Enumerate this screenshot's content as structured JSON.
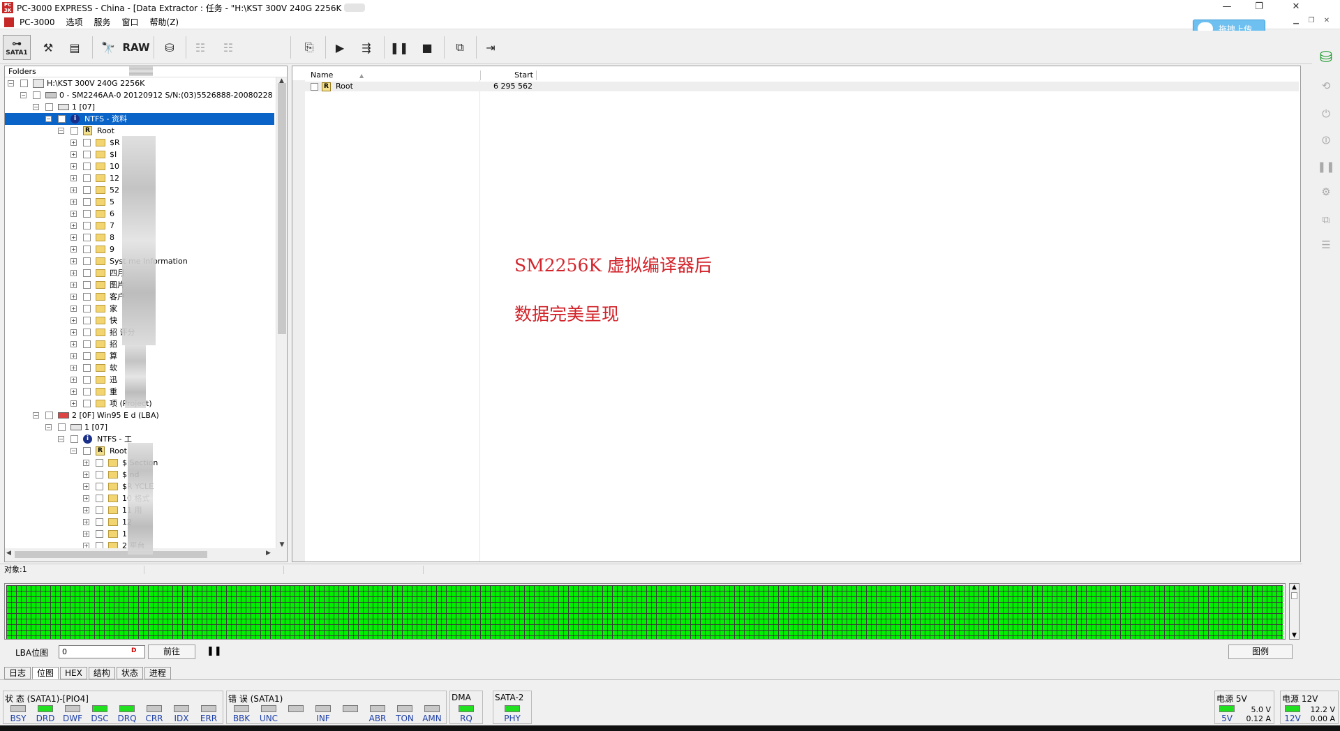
{
  "window": {
    "title": "PC-3000 EXPRESS - China - [Data Extractor : 任务 - \"H:\\KST 300V 240G  2256K",
    "controls": [
      "—",
      "❐",
      "✕"
    ]
  },
  "menu": {
    "items": [
      "PC-3000",
      "选项",
      "服务",
      "窗口",
      "帮助(Z)"
    ]
  },
  "cloud_upload": {
    "label": "拖拽上传"
  },
  "toolbar": {
    "sata_label": "SATA1",
    "raw_label": "RAW"
  },
  "folders": {
    "header": "Folders",
    "tree": [
      {
        "label": "H:\\KST 300V 240G  2256K",
        "exp": "−"
      },
      {
        "label": "0 - SM2246AA-0 20120912 S/N:(03)5526888-20080228",
        "exp": "−"
      },
      {
        "label": "1 [07]",
        "exp": "−"
      },
      {
        "label": "NTFS - 资料",
        "exp": "−"
      },
      {
        "label": "Root",
        "exp": "−"
      },
      {
        "label": "$R",
        "exp": "+"
      },
      {
        "label": "$I",
        "exp": "+"
      },
      {
        "label": "10",
        "exp": "+"
      },
      {
        "label": "12",
        "exp": "+"
      },
      {
        "label": "52",
        "exp": "+"
      },
      {
        "label": "5",
        "exp": "+"
      },
      {
        "label": "6",
        "exp": "+"
      },
      {
        "label": "7",
        "exp": "+"
      },
      {
        "label": "8",
        "exp": "+"
      },
      {
        "label": "9",
        "exp": "+"
      },
      {
        "label": "Syst          me Information",
        "exp": "+"
      },
      {
        "label": "四月",
        "exp": "+"
      },
      {
        "label": "图片",
        "exp": "+"
      },
      {
        "label": "客户",
        "exp": "+"
      },
      {
        "label": "家",
        "exp": "+"
      },
      {
        "label": "快",
        "exp": "+"
      },
      {
        "label": "招            评分",
        "exp": "+"
      },
      {
        "label": "招",
        "exp": "+"
      },
      {
        "label": "算",
        "exp": "+"
      },
      {
        "label": "软",
        "exp": "+"
      },
      {
        "label": "迅",
        "exp": "+"
      },
      {
        "label": "重",
        "exp": "+"
      },
      {
        "label": "项             (Project)",
        "exp": "+"
      },
      {
        "label": "2 [0F] Win95 E       d  (LBA)",
        "exp": "−"
      },
      {
        "label": "1 [07]",
        "exp": "−"
      },
      {
        "label": "NTFS - 工",
        "exp": "−"
      },
      {
        "label": "Root",
        "exp": "−"
      },
      {
        "label": "$       Section",
        "exp": "+"
      },
      {
        "label": "$       nd",
        "exp": "+"
      },
      {
        "label": "$R      YCLE",
        "exp": "+"
      },
      {
        "label": "10      格式",
        "exp": "+"
      },
      {
        "label": "11      用",
        "exp": "+"
      },
      {
        "label": "12",
        "exp": "+"
      },
      {
        "label": "1",
        "exp": "+"
      },
      {
        "label": "2           平台",
        "exp": "+"
      }
    ]
  },
  "files": {
    "columns": [
      "Name",
      "Start"
    ],
    "rows": [
      {
        "name": "Root",
        "start": "6 295 562"
      }
    ]
  },
  "overlay": {
    "line1": "SM2256K  虚拟编译器后",
    "line2": "数据完美呈现"
  },
  "status_bar": {
    "objects": "对象:1"
  },
  "lba_bar": {
    "label": "LBA位图",
    "value": "0",
    "go_label": "前往",
    "legend_label": "图例"
  },
  "tabs": [
    "日志",
    "位图",
    "HEX",
    "结构",
    "状态",
    "进程"
  ],
  "active_tab": "位图",
  "indicators": {
    "status": {
      "title": "状 态 (SATA1)-[PIO4]",
      "leds": [
        {
          "name": "BSY",
          "on": false
        },
        {
          "name": "DRD",
          "on": true
        },
        {
          "name": "DWF",
          "on": false
        },
        {
          "name": "DSC",
          "on": true
        },
        {
          "name": "DRQ",
          "on": true
        },
        {
          "name": "CRR",
          "on": false
        },
        {
          "name": "IDX",
          "on": false
        },
        {
          "name": "ERR",
          "on": false
        }
      ]
    },
    "errors": {
      "title": "错 误 (SATA1)",
      "leds": [
        {
          "name": "BBK",
          "on": false
        },
        {
          "name": "UNC",
          "on": false
        },
        {
          "name": "",
          "on": false
        },
        {
          "name": "INF",
          "on": false
        },
        {
          "name": "",
          "on": false
        },
        {
          "name": "ABR",
          "on": false
        },
        {
          "name": "TON",
          "on": false
        },
        {
          "name": "AMN",
          "on": false
        }
      ]
    },
    "dma": {
      "title": "DMA",
      "led": "RQ"
    },
    "sata2": {
      "title": "SATA-2",
      "led": "PHY"
    },
    "power5": {
      "title": "电源 5V",
      "led": "5V",
      "voltage": "5.0 V",
      "current": "0.12 A"
    },
    "power12": {
      "title": "电源 12V",
      "led": "12V",
      "voltage": "12.2 V",
      "current": "0.00 A"
    }
  },
  "colors": {
    "selection": "#0a64c8",
    "map_ok": "#00f000",
    "overlay_text": "#d2232a",
    "led_on": "#20e020"
  }
}
